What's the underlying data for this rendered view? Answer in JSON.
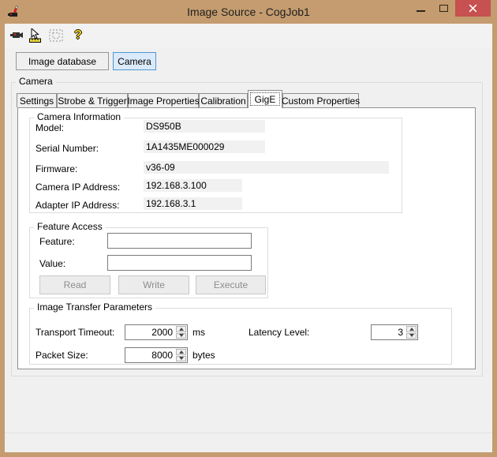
{
  "window": {
    "title": "Image Source - CogJob1"
  },
  "colors": {
    "titlebar": "#c49c6f",
    "close_button": "#c75050",
    "client_background": "#f0f0f0",
    "tab_page_background": "#ffffff",
    "active_button_bg": "#dbeafa",
    "active_button_border": "#4f97cf"
  },
  "toolbar": {
    "icons": [
      "camcorder",
      "pointer-ruler",
      "region-disabled",
      "help"
    ]
  },
  "source_selector": {
    "image_database": "Image database",
    "camera": "Camera"
  },
  "camera_section": {
    "label": "Camera"
  },
  "tabs": [
    {
      "label": "Settings",
      "selected": false
    },
    {
      "label": "Strobe & Trigger",
      "selected": false
    },
    {
      "label": "Image Properties",
      "selected": false
    },
    {
      "label": "Calibration",
      "selected": false
    },
    {
      "label": "GigE",
      "selected": true
    },
    {
      "label": "Custom Properties",
      "selected": false
    }
  ],
  "camera_information": {
    "label": "Camera Information",
    "fields": [
      {
        "label": "Model:",
        "value": "DS950B"
      },
      {
        "label": "Serial Number:",
        "value": "1A1435ME000029"
      },
      {
        "label": "Firmware:",
        "value": "v36-09"
      },
      {
        "label": "Camera IP Address:",
        "value": "192.168.3.100"
      },
      {
        "label": "Adapter IP Address:",
        "value": "192.168.3.1"
      }
    ]
  },
  "feature_access": {
    "label": "Feature Access",
    "feature": {
      "label": "Feature:",
      "value": ""
    },
    "value": {
      "label": "Value:",
      "value": ""
    },
    "buttons": {
      "read": "Read",
      "write": "Write",
      "execute": "Execute"
    }
  },
  "image_transfer": {
    "label": "Image Transfer Parameters",
    "transport_timeout": {
      "label": "Transport Timeout:",
      "value": "2000",
      "unit": "ms"
    },
    "packet_size": {
      "label": "Packet Size:",
      "value": "8000",
      "unit": "bytes"
    },
    "latency_level": {
      "label": "Latency Level:",
      "value": "3"
    }
  }
}
